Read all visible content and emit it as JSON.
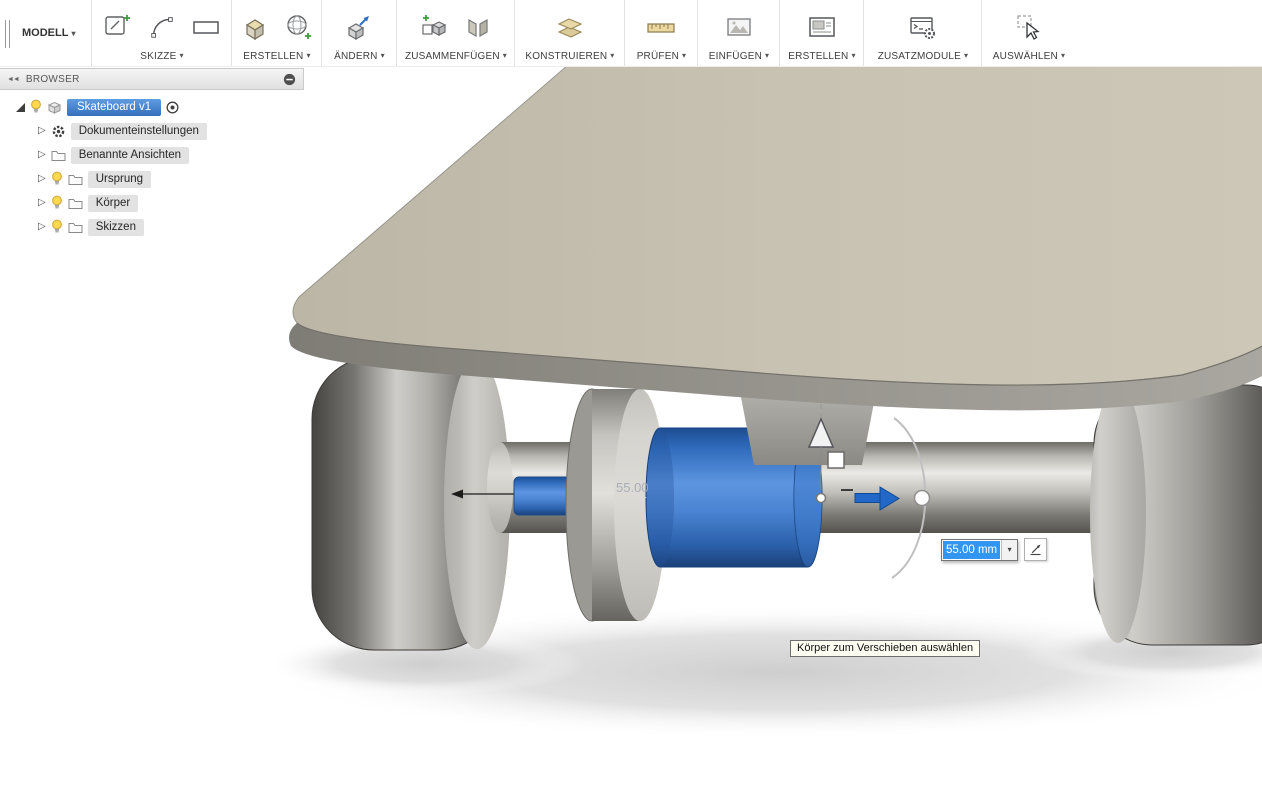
{
  "icons": {
    "dropdown_caret": "▾",
    "panel_collapse": "◄◄",
    "tree_collapsed": "▷"
  },
  "toolbar": {
    "workspace": "MODELL",
    "groups": [
      {
        "label": "SKIZZE"
      },
      {
        "label": "ERSTELLEN"
      },
      {
        "label": "ÄNDERN"
      },
      {
        "label": "ZUSAMMENFÜGEN"
      },
      {
        "label": "KONSTRUIEREN"
      },
      {
        "label": "PRÜFEN"
      },
      {
        "label": "EINFÜGEN"
      },
      {
        "label": "ERSTELLEN"
      },
      {
        "label": "ZUSATZMODULE"
      },
      {
        "label": "AUSWÄHLEN"
      }
    ]
  },
  "browser": {
    "title": "BROWSER",
    "root": {
      "label": "Skateboard v1"
    },
    "items": [
      {
        "label": "Dokumenteinstellungen"
      },
      {
        "label": "Benannte Ansichten"
      },
      {
        "label": "Ursprung"
      },
      {
        "label": "Körper"
      },
      {
        "label": "Skizzen"
      }
    ]
  },
  "viewport": {
    "dimension_label": "55.00",
    "move_input_value": "55.00 mm",
    "tooltip": "Körper zum Verschieben auswählen"
  },
  "colors": {
    "selection_blue": "#3b79c9",
    "text_selection_blue": "#3296f0",
    "deck_tan": "#c7c1b1"
  }
}
